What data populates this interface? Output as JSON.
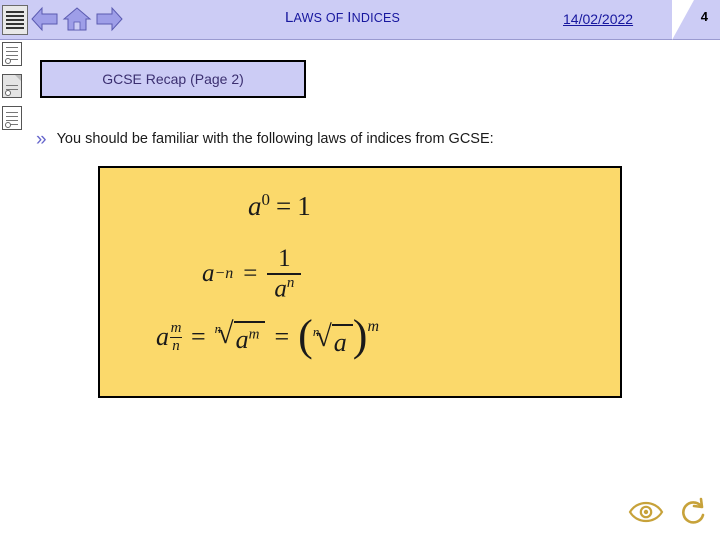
{
  "topbar": {
    "nav": {
      "menu_icon": "lines-icon",
      "back_icon": "arrow-left-icon",
      "home_icon": "home-icon",
      "forward_icon": "arrow-right-icon"
    },
    "title_part1": "L",
    "title_part2": "AWS OF ",
    "title_part3": "I",
    "title_part4": "NDICES",
    "date": "14/02/2022",
    "page_number": "4"
  },
  "rail": {
    "items": [
      {
        "name": "outline-panel-icon",
        "label": ""
      },
      {
        "name": "notes-page-icon",
        "label": ""
      },
      {
        "name": "slide-page-icon",
        "label": ""
      }
    ]
  },
  "main": {
    "recap_label_caps": "GCSE R",
    "recap_label": "GCSE Recap (Page 2)",
    "bullet_marker": "»",
    "bullet_text": "You should be familiar with the following laws of indices from GCSE:",
    "formulas": {
      "line1": {
        "base": "a",
        "exponent": "0",
        "equals": "=",
        "result": "1"
      },
      "line2": {
        "base": "a",
        "exponent": "−n",
        "equals": "=",
        "numerator": "1",
        "denominator_base": "a",
        "denominator_exp": "n"
      },
      "line3": {
        "base": "a",
        "frac_num": "m",
        "frac_den": "n",
        "equals1": "=",
        "radical_index": "n",
        "radical_body_base": "a",
        "radical_body_exp": "m",
        "equals2": "=",
        "outer_index": "n",
        "outer_body": "a",
        "outer_exp": "m"
      }
    }
  },
  "footer": {
    "eye_icon": "eye-icon",
    "undo_icon": "undo-icon"
  },
  "colors": {
    "topbar_bg": "#ccccf5",
    "title_blue": "#17179e",
    "panel_yellow": "#fbd96b",
    "bullet_purple": "#6666cc"
  }
}
